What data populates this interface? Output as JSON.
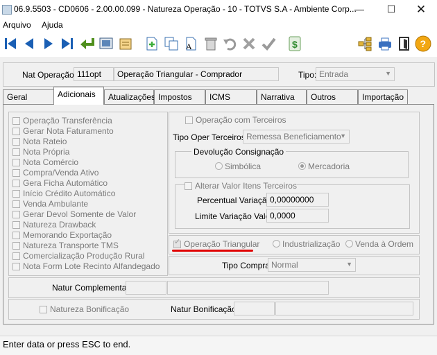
{
  "window": {
    "title": "06.9.5503 - CD0606 - 2.00.00.099 - Natureza Operação - 10 - TOTVS S.A - Ambiente Corp..."
  },
  "menu": {
    "items": [
      "Arquivo",
      "Ajuda"
    ]
  },
  "toolbar": {
    "icons": [
      "first-icon",
      "previous-icon",
      "next-icon",
      "last-icon",
      "goto-icon",
      "search-icon",
      "list-icon",
      "new-icon",
      "copy-icon",
      "edit-icon",
      "delete-icon",
      "undo-icon",
      "cancel-icon",
      "confirm-icon",
      "money-icon",
      "hierarchy-icon",
      "print-icon",
      "exit-icon",
      "help-icon"
    ]
  },
  "header": {
    "nat_label": "Nat Operação:",
    "nat_code": "111opt",
    "nat_desc": "Operação Triangular - Comprador",
    "tipo_label": "Tipo:",
    "tipo_value": "Entrada"
  },
  "tabs": [
    "Geral",
    "Adicionais",
    "Atualizações",
    "Impostos",
    "ICMS",
    "Narrativa",
    "Outros",
    "Importação"
  ],
  "left_checks": [
    "Operação Transferência",
    "Gerar Nota Faturamento",
    "Nota Rateio",
    "Nota Própria",
    "Nota Comércio",
    "Compra/Venda Ativo",
    "Gera Ficha Automático",
    "Início Crédito Automático",
    "Venda Ambulante",
    "Gerar Devol Somente de Valor",
    "Natureza Drawback",
    "Memorando Exportação",
    "Natureza Transporte TMS",
    "Comercialização Produção Rural",
    "Nota Form Lote Recinto Alfandegado"
  ],
  "terceiros": {
    "check_label": "Operação com Terceiros",
    "tipo_oper_label": "Tipo Oper Terceiros:",
    "tipo_oper_value": "Remessa Beneficiamento",
    "devolucao_title": "Devolução Consignação",
    "radio_simbolica": "Simbólica",
    "radio_mercadoria": "Mercadoria",
    "alterar_label": "Alterar Valor Itens Terceiros",
    "perc_label": "Percentual Variação:",
    "perc_value": "0,00000000",
    "limite_label": "Limite Variação Valor:",
    "limite_value": "0,0000"
  },
  "triangular": {
    "check_label": "Operação Triangular",
    "radio_industrializacao": "Industrialização",
    "radio_venda": "Venda à Ordem",
    "underline_color": "#e00000"
  },
  "compra": {
    "label": "Tipo Compra:",
    "value": "Normal"
  },
  "complementar": {
    "label": "Natur Complementar:"
  },
  "bonificacao": {
    "check_label": "Natureza Bonificação",
    "label": "Natur Bonificação:"
  },
  "status": {
    "text": "Enter data or press ESC to end."
  }
}
